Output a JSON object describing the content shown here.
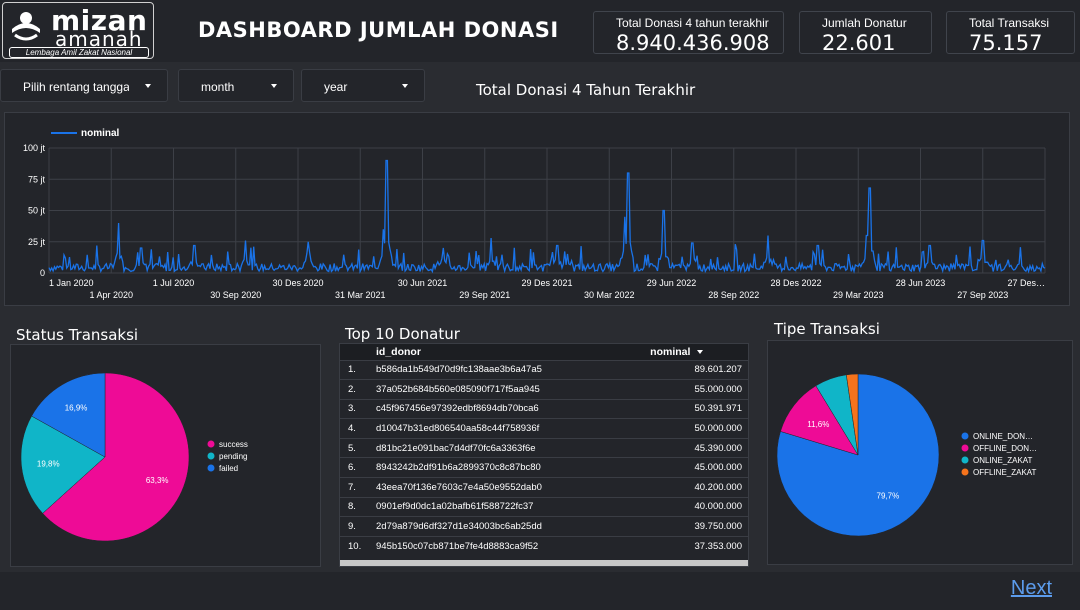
{
  "header": {
    "logo_top": "mizan",
    "logo_bottom": "amanah",
    "logo_sub": "Lembaga Amil Zakat Nasional",
    "title": "DASHBOARD JUMLAH DONASI"
  },
  "kpis": [
    {
      "label": "Total Donasi 4 tahun terakhir",
      "value": "8.940.436.908"
    },
    {
      "label": "Jumlah Donatur",
      "value": "22.601"
    },
    {
      "label": "Total Transaksi",
      "value": "75.157"
    }
  ],
  "filters": [
    {
      "label": "Pilih rentang tanggal"
    },
    {
      "label": "month"
    },
    {
      "label": "year"
    }
  ],
  "colors": {
    "background": "#2a2c31",
    "panel": "#23252a",
    "line": "#1a73e8",
    "success": "#ee0b96",
    "pending": "#10b5c8",
    "failed": "#1a73e8",
    "offline_zakat": "#f5731c",
    "link": "#5c9cec"
  },
  "chart_data": [
    {
      "type": "line",
      "title": "Total Donasi 4 Tahun Terakhir",
      "series_name": "nominal",
      "y_ticks": [
        "0",
        "25 jt",
        "50 jt",
        "75 jt",
        "100 jt"
      ],
      "ylim": [
        0,
        100
      ],
      "x_ticks_row1": [
        "1 Jan 2020",
        "1 Jul 2020",
        "30 Des 2020",
        "30 Jun 2021",
        "29 Des 2021",
        "29 Jun 2022",
        "28 Des 2022",
        "28 Jun 2023",
        "27 Des…"
      ],
      "x_ticks_row2": [
        "1 Apr 2020",
        "30 Sep 2020",
        "31 Mar 2021",
        "29 Sep 2021",
        "30 Mar 2022",
        "28 Sep 2022",
        "29 Mar 2023",
        "27 Sep 2023"
      ],
      "xlim": [
        "2020-01-01",
        "2023-12-31"
      ],
      "peaks": [
        {
          "date": "2020-04-12",
          "value": 40
        },
        {
          "date": "2020-05-15",
          "value": 20
        },
        {
          "date": "2020-08-01",
          "value": 22
        },
        {
          "date": "2020-10-15",
          "value": 26
        },
        {
          "date": "2021-01-15",
          "value": 25
        },
        {
          "date": "2021-05-05",
          "value": 35
        },
        {
          "date": "2021-05-10",
          "value": 90
        },
        {
          "date": "2021-08-01",
          "value": 20
        },
        {
          "date": "2021-10-10",
          "value": 28
        },
        {
          "date": "2022-01-15",
          "value": 22
        },
        {
          "date": "2022-04-24",
          "value": 45
        },
        {
          "date": "2022-04-29",
          "value": 80
        },
        {
          "date": "2022-06-20",
          "value": 50
        },
        {
          "date": "2022-08-01",
          "value": 24
        },
        {
          "date": "2022-11-20",
          "value": 30
        },
        {
          "date": "2023-02-01",
          "value": 22
        },
        {
          "date": "2023-04-14",
          "value": 30
        },
        {
          "date": "2023-04-18",
          "value": 68
        },
        {
          "date": "2023-07-15",
          "value": 22
        },
        {
          "date": "2023-10-01",
          "value": 26
        }
      ],
      "baseline_typical": 4,
      "grid": true,
      "legend": "top-left"
    },
    {
      "type": "pie",
      "title": "Status Transaksi",
      "labels": [
        "success",
        "pending",
        "failed"
      ],
      "values": [
        63.3,
        19.8,
        16.9
      ],
      "value_labels": [
        "63,3%",
        "19,8%",
        "16,9%"
      ],
      "legend": "right"
    },
    {
      "type": "pie",
      "title": "Tipe Transaksi",
      "labels": [
        "ONLINE_DON…",
        "OFFLINE_DON…",
        "ONLINE_ZAKAT",
        "OFFLINE_ZAKAT"
      ],
      "values": [
        79.7,
        11.6,
        6.4,
        2.3
      ],
      "value_labels": [
        "79,7%",
        "11,6%",
        "",
        ""
      ],
      "legend": "right"
    }
  ],
  "top10": {
    "title": "Top 10 Donatur",
    "col_id": "id_donor",
    "col_nominal": "nominal",
    "rows": [
      {
        "rank": "1.",
        "id": "b586da1b549d70d9fc138aae3b6a47a5",
        "nominal": "89.601.207"
      },
      {
        "rank": "2.",
        "id": "37a052b684b560e085090f717f5aa945",
        "nominal": "55.000.000"
      },
      {
        "rank": "3.",
        "id": "c45f967456e97392edbf8694db70bca6",
        "nominal": "50.391.971"
      },
      {
        "rank": "4.",
        "id": "d10047b31ed806540aa58c44f758936f",
        "nominal": "50.000.000"
      },
      {
        "rank": "5.",
        "id": "d81bc21e091bac7d4df70fc6a3363f6e",
        "nominal": "45.390.000"
      },
      {
        "rank": "6.",
        "id": "8943242b2df91b6a2899370c8c87bc80",
        "nominal": "45.000.000"
      },
      {
        "rank": "7.",
        "id": "43eea70f136e7603c7e4a50e9552dab0",
        "nominal": "40.200.000"
      },
      {
        "rank": "8.",
        "id": "0901ef9d0dc1a02bafb61f588722fc37",
        "nominal": "40.000.000"
      },
      {
        "rank": "9.",
        "id": "2d79a879d6df327d1e34003bc6ab25dd",
        "nominal": "39.750.000"
      },
      {
        "rank": "10.",
        "id": "945b150c07cb871be7fe4d8883ca9f52",
        "nominal": "37.353.000"
      }
    ]
  },
  "nav": {
    "next_label": "Next"
  }
}
